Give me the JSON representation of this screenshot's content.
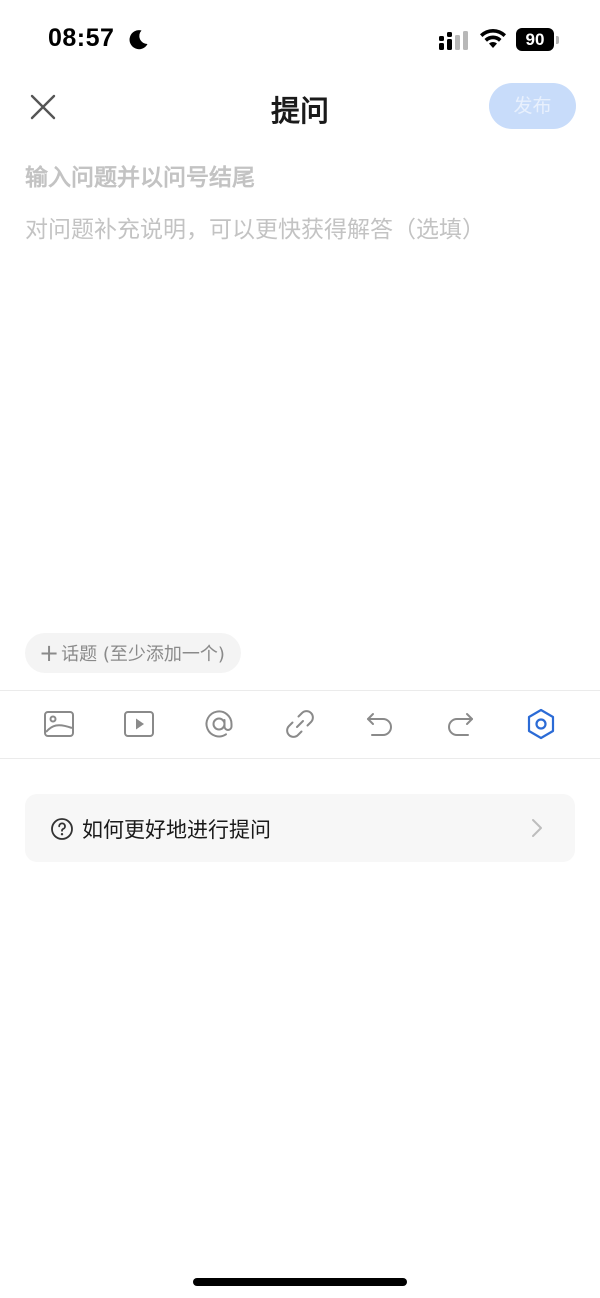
{
  "status_bar": {
    "time": "08:57",
    "battery_level": "90",
    "icons": [
      "moon-icon",
      "signal-icon",
      "wifi-icon",
      "battery-icon"
    ]
  },
  "nav": {
    "title": "提问",
    "publish_label": "发布",
    "close_icon": "close-icon"
  },
  "editor": {
    "title_placeholder": "输入问题并以问号结尾",
    "description_placeholder": "对问题补充说明，可以更快获得解答（选填）"
  },
  "topic": {
    "plus": "+",
    "label": "话题 (至少添加一个)"
  },
  "toolbar": {
    "tools": [
      "image-icon",
      "video-icon",
      "at-icon",
      "link-icon",
      "undo-icon",
      "redo-icon",
      "settings-hex-icon"
    ]
  },
  "help": {
    "label": "如何更好地进行提问"
  },
  "colors": {
    "accent": "#2b6bd6",
    "publish_disabled_bg": "#c8dcfa",
    "placeholder": "#c3c3c3"
  }
}
